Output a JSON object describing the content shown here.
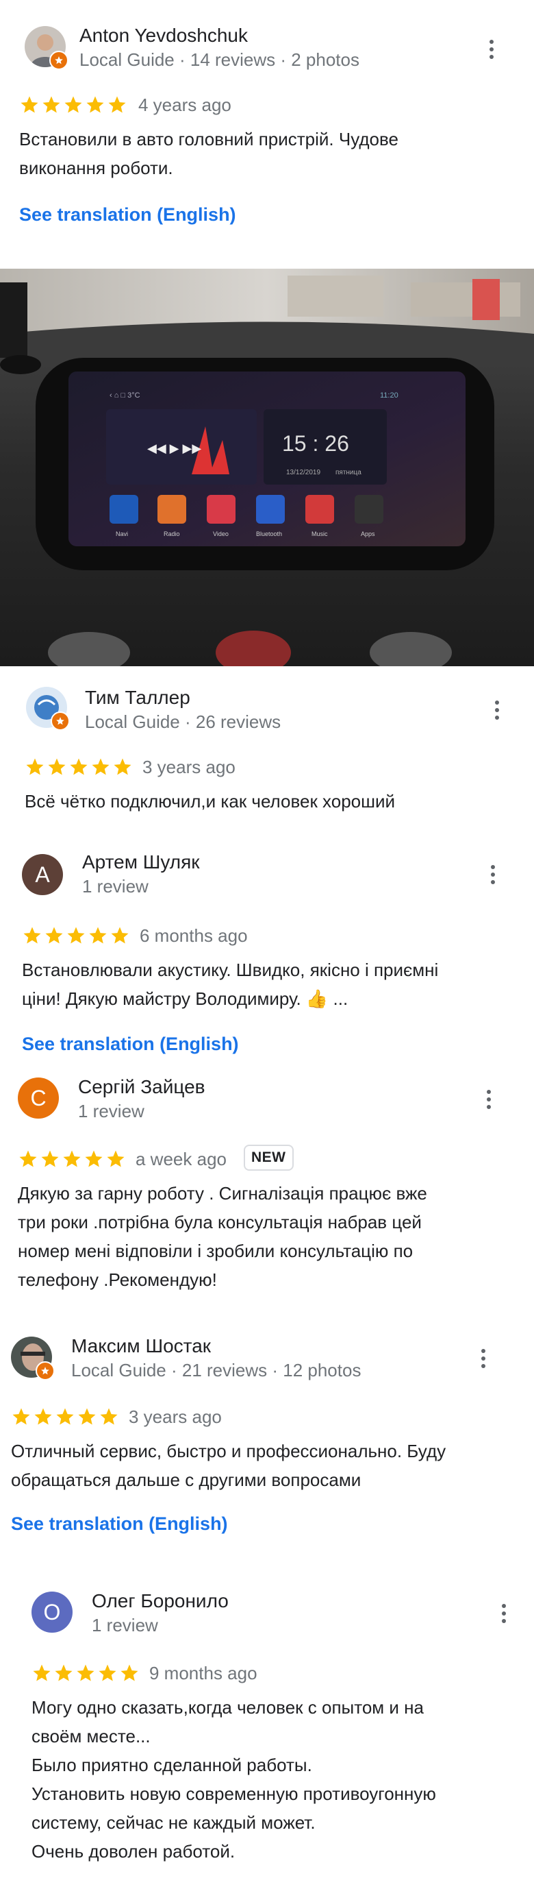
{
  "translate_label": "See translation (English)",
  "reviews": [
    {
      "name": "Anton Yevdoshchuk",
      "meta": "Local Guide · 14 reviews · 2 photos",
      "age": "4 years ago",
      "rating": 5,
      "text": "Встановили в авто головний пристрій. Чудове\nвиконання роботи."
    },
    {
      "name": "Тим Таллер",
      "meta": "Local Guide · 26 reviews",
      "age": "3 years ago",
      "rating": 5,
      "text": "Всё чётко подключил,и как человек хороший"
    },
    {
      "name": "Артем Шуляк",
      "meta": "1 review",
      "avatar_letter": "A",
      "age": "6 months ago",
      "rating": 5,
      "text": "Встановлювали акустику. Швидко, якісно і приємні\nціни! Дякую майстру Володимиру. 👍 ..."
    },
    {
      "name": "Сергій Зайцев",
      "meta": "1 review",
      "avatar_letter": "C",
      "age": "a week ago",
      "badge": "NEW",
      "rating": 5,
      "text": "Дякую за гарну роботу . Сигналізація працює вже\nтри роки .потрібна була консультація набрав цей\nномер мені відповіли і зробили консультацію по\nтелефону .Рекомендую!"
    },
    {
      "name": "Максим Шостак",
      "meta": "Local Guide · 21 reviews · 12 photos",
      "age": "3 years ago",
      "rating": 5,
      "text": "Отличный сервис, быстро и профессионально. Буду\nобращаться дальше с другими вопросами"
    },
    {
      "name": "Олег Боронило",
      "meta": "1 review",
      "avatar_letter": "O",
      "age": "9 months ago",
      "rating": 5,
      "text": "Могу одно сказать,когда человек с опытом и на\nсвоём месте...\nБыло приятно сделанной работы.\nУстановить новую современную противоугонную\nсистему, сейчас не каждый может.\nОчень доволен работой."
    }
  ],
  "photo": {
    "status_time": "11:20",
    "clock": "15 : 26",
    "date": "13/12/2019",
    "weekday": "пятница",
    "apps": [
      "Navi",
      "Radio",
      "Video",
      "Bluetooth",
      "Music",
      "Apps"
    ]
  },
  "colors": {
    "star": "#fbbc04",
    "link": "#1a73e8",
    "avatar_a": "#5d4037",
    "avatar_c": "#e8710a",
    "avatar_o": "#5c6bc0"
  }
}
